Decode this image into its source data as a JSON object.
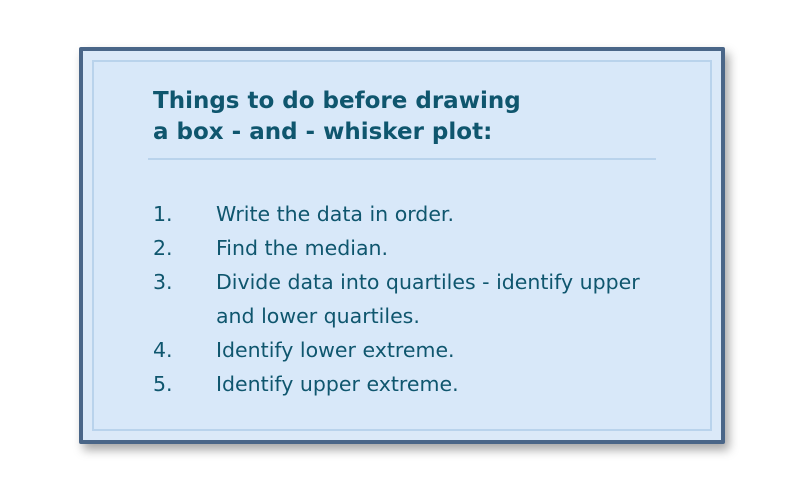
{
  "title": {
    "line1": "Things to do before drawing",
    "line2": "a box - and - whisker plot:"
  },
  "steps": [
    {
      "number": "1.",
      "text": "Write the data in order."
    },
    {
      "number": "2.",
      "text": "Find the median."
    },
    {
      "number": "3.",
      "text": "Divide data into quartiles - identify upper and lower quartiles."
    },
    {
      "number": "4.",
      "text": "Identify lower extreme."
    },
    {
      "number": "5.",
      "text": "Identify upper extreme."
    }
  ]
}
